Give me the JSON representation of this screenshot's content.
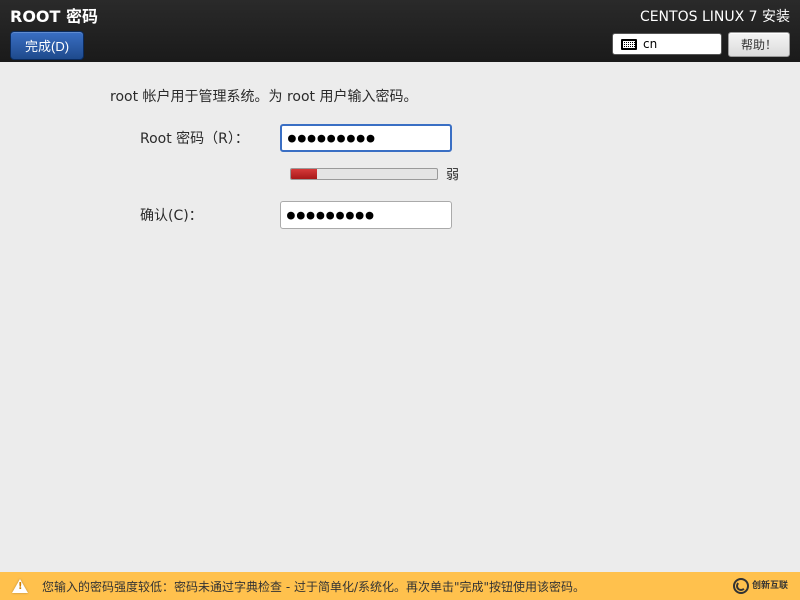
{
  "header": {
    "page_title": "ROOT 密码",
    "done_button": "完成(D)",
    "install_title": "CENTOS LINUX 7 安装",
    "keyboard_layout": "cn",
    "help_button": "帮助！"
  },
  "main": {
    "instruction": "root 帐户用于管理系统。为 root 用户输入密码。",
    "password_label": "Root 密码（R）：",
    "password_value": "●●●●●●●●●",
    "confirm_label": "确认(C)：",
    "confirm_value": "●●●●●●●●●",
    "strength_text": "弱",
    "strength_percent": 18
  },
  "warning": {
    "message": "您输入的密码强度较低：密码未通过字典检查 - 过于简单化/系统化。再次单击\"完成\"按钮使用该密码。"
  },
  "logo": {
    "brand": "创新互联"
  }
}
